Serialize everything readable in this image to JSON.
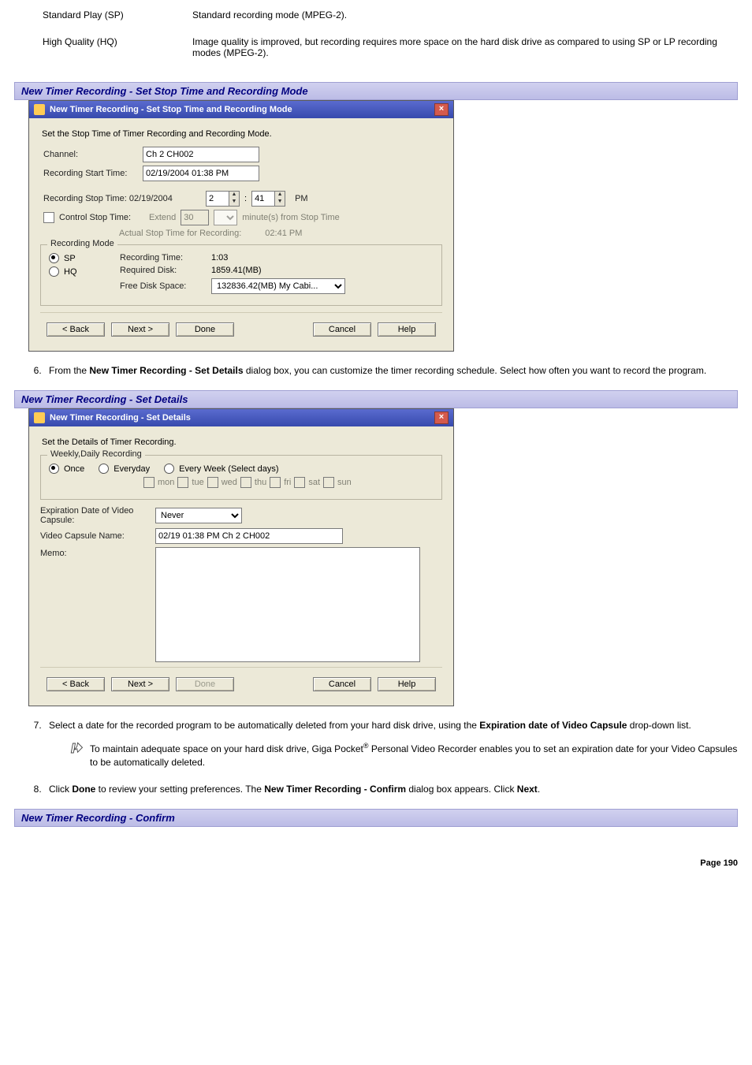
{
  "def_sp": {
    "term": "Standard Play (SP)",
    "body": "Standard recording mode (MPEG-2)."
  },
  "def_hq": {
    "term": "High Quality (HQ)",
    "body": "Image quality is improved, but recording requires more space on the hard disk drive as compared to using SP or LP recording modes (MPEG-2)."
  },
  "sections": {
    "stop_time": "New Timer Recording - Set Stop Time and Recording Mode",
    "details": "New Timer Recording - Set Details",
    "confirm": "New Timer Recording - Confirm"
  },
  "dialog1": {
    "title": "New Timer Recording - Set Stop Time and Recording Mode",
    "subtitle": "Set the Stop Time of Timer Recording and Recording Mode.",
    "channel_label": "Channel:",
    "channel_value": "Ch 2 CH002",
    "start_label": "Recording Start Time:",
    "start_value": "02/19/2004 01:38 PM",
    "stop_label": "Recording Stop Time: 02/19/2004",
    "stop_hour": "2",
    "stop_min": "41",
    "stop_ampm": "PM",
    "control_label": "Control Stop Time:",
    "control_extend": "Extend",
    "control_minutes_value": "30",
    "control_minutes_suffix": "minute(s) from Stop Time",
    "actual_label": "Actual Stop Time for Recording:",
    "actual_value": "02:41 PM",
    "rec_mode_legend": "Recording Mode",
    "mode_sp": "SP",
    "mode_hq": "HQ",
    "rec_time_label": "Recording Time:",
    "rec_time_value": "1:03",
    "req_disk_label": "Required Disk:",
    "req_disk_value": "1859.41(MB)",
    "free_disk_label": "Free Disk Space:",
    "free_disk_value": "132836.42(MB) My Cabi...",
    "btn_back": "< Back",
    "btn_next": "Next >",
    "btn_done": "Done",
    "btn_cancel": "Cancel",
    "btn_help": "Help",
    "close": "×"
  },
  "step6": {
    "prefix": "From the ",
    "bold": "New Timer Recording - Set Details",
    "suffix": " dialog box, you can customize the timer recording schedule. Select how often you want to record the program."
  },
  "dialog2": {
    "title": "New Timer Recording - Set Details",
    "subtitle": "Set the Details of Timer Recording.",
    "freq_legend": "Weekly,Daily Recording",
    "freq_once": "Once",
    "freq_every": "Everyday",
    "freq_week": "Every Week (Select days)",
    "days": {
      "mon": "mon",
      "tue": "tue",
      "wed": "wed",
      "thu": "thu",
      "fri": "fri",
      "sat": "sat",
      "sun": "sun"
    },
    "exp_label": "Expiration Date of Video Capsule:",
    "exp_value": "Never",
    "name_label": "Video Capsule Name:",
    "name_value": "02/19 01:38 PM Ch 2 CH002",
    "memo_label": "Memo:",
    "memo_value": "",
    "btn_back": "< Back",
    "btn_next": "Next >",
    "btn_done": "Done",
    "btn_cancel": "Cancel",
    "btn_help": "Help",
    "close": "×"
  },
  "step7": {
    "line1a": "Select a date for the recorded program to be automatically deleted from your hard disk drive, using the ",
    "line1b_bold": "Expiration date of Video Capsule",
    "line1c": " drop-down list."
  },
  "note": {
    "text_a": "To maintain adequate space on your hard disk drive, Giga Pocket",
    "reg": "®",
    "text_b": " Personal Video Recorder enables you to set an expiration date for your Video Capsules to be automatically deleted."
  },
  "step8": {
    "a": "Click ",
    "b_bold": "Done",
    "c": " to review your setting preferences. The ",
    "d_bold": "New Timer Recording - Confirm",
    "e": " dialog box appears. Click ",
    "f_bold": "Next",
    "g": "."
  },
  "footer": "Page 190"
}
